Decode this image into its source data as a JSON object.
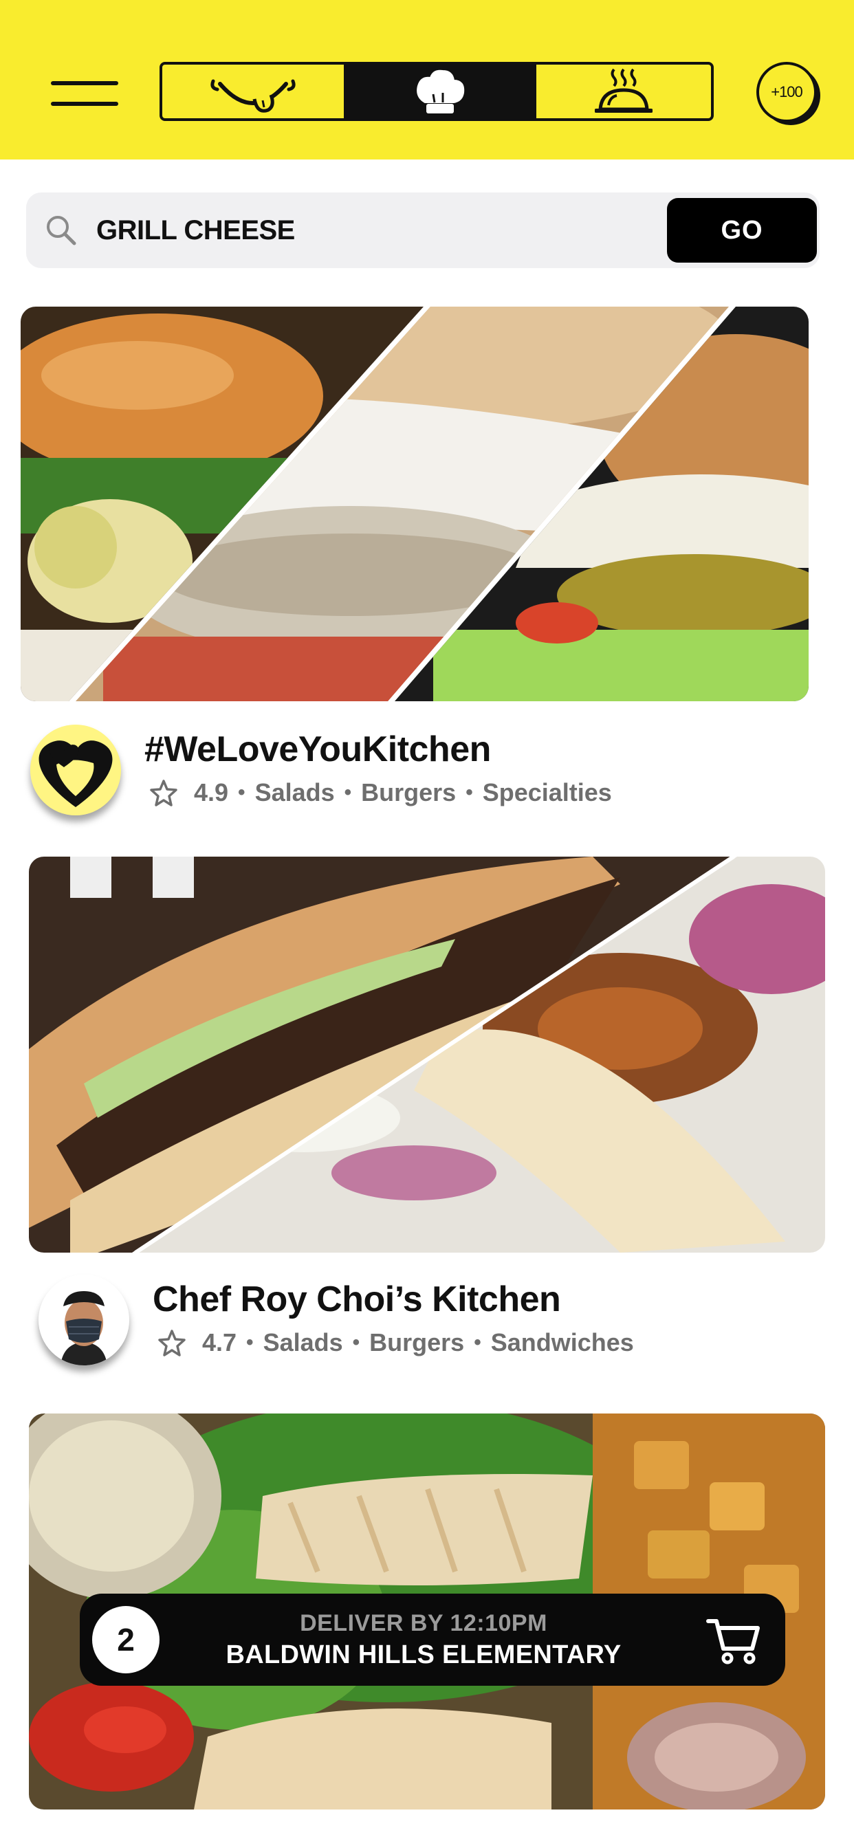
{
  "header": {
    "tabs": [
      {
        "icon": "tongue-smile-icon",
        "selected": false
      },
      {
        "icon": "chef-hat-icon",
        "selected": true
      },
      {
        "icon": "food-cloche-icon",
        "selected": false
      }
    ],
    "points_badge": "+100",
    "colors": {
      "brand_yellow": "#f9ec2e",
      "ink": "#111111"
    }
  },
  "search": {
    "query": "GRILL CHEESE",
    "go_label": "GO"
  },
  "kitchens": [
    {
      "name": "#WeLoveYouKitchen",
      "rating": "4.9",
      "categories": [
        "Salads",
        "Burgers",
        "Specialties"
      ],
      "logo_icon": "heart-logo-icon"
    },
    {
      "name": "Chef Roy Choi’s Kitchen",
      "rating": "4.7",
      "categories": [
        "Salads",
        "Burgers",
        "Sandwiches"
      ],
      "logo_icon": "chef-avatar"
    }
  ],
  "cart": {
    "count": "2",
    "deliver_by": "DELIVER BY 12:10PM",
    "location": "BALDWIN HILLS ELEMENTARY"
  }
}
